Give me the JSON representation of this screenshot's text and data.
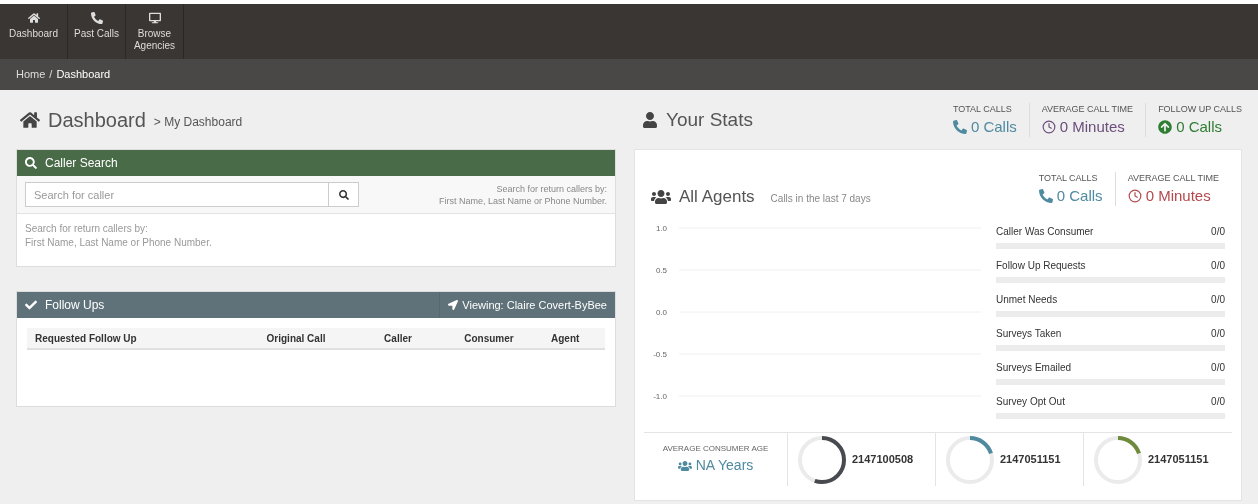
{
  "nav": [
    {
      "kind": "home",
      "label": "Dashboard"
    },
    {
      "kind": "phone",
      "label": "Past Calls"
    },
    {
      "kind": "monitor",
      "label": "Browse Agencies"
    }
  ],
  "breadcrumb": {
    "home": "Home",
    "separator": "/",
    "current": "Dashboard"
  },
  "page_title": {
    "title": "Dashboard",
    "subtitle": "> My Dashboard"
  },
  "caller_search": {
    "title": "Caller Search",
    "placeholder": "Search for caller",
    "hint_right": [
      "Search for return callers by:",
      "First Name, Last Name or Phone Number."
    ],
    "hint_body": [
      "Search for return callers by:",
      "First Name, Last Name or Phone Number."
    ]
  },
  "follow_ups": {
    "title": "Follow Ups",
    "viewing": "Viewing: Claire Covert-ByBee",
    "columns": [
      "Requested Follow Up",
      "Original Call",
      "Caller",
      "Consumer",
      "Agent"
    ]
  },
  "your_stats": {
    "title": "Your Stats",
    "stats": [
      {
        "kind": "phone",
        "label": "TOTAL CALLS",
        "value": "0 Calls",
        "color": "#4f8aa1"
      },
      {
        "kind": "clock",
        "label": "AVERAGE CALL TIME",
        "value": "0 Minutes",
        "color": "#6b4e7a"
      },
      {
        "kind": "up",
        "label": "FOLLOW UP CALLS",
        "value": "0 Calls",
        "color": "#2f7d32"
      }
    ]
  },
  "all_agents": {
    "title": "All Agents",
    "subtitle": "Calls in the last 7 days",
    "stats": [
      {
        "kind": "phone",
        "label": "TOTAL CALLS",
        "value": "0 Calls",
        "color": "#4f8aa1"
      },
      {
        "kind": "clock",
        "label": "AVERAGE CALL TIME",
        "value": "0 Minutes",
        "color": "#b5484c"
      }
    ],
    "empty_chart": {
      "y_axis_labels": [
        "1.0",
        "0.5",
        "0.0",
        "-0.5",
        "-1.0"
      ]
    },
    "metrics": [
      {
        "label": "Caller Was Consumer",
        "reading": "0/0",
        "level": 0
      },
      {
        "label": "Follow Up Requests",
        "reading": "0/0",
        "level": 0
      },
      {
        "label": "Unmet Needs",
        "reading": "0/0",
        "level": 0
      },
      {
        "label": "Surveys Taken",
        "reading": "0/0",
        "level": 0
      },
      {
        "label": "Surveys Emailed",
        "reading": "0/0",
        "level": 0
      },
      {
        "label": "Survey Opt Out",
        "reading": "0/0",
        "level": 0
      }
    ],
    "consumer_age": {
      "label": "AVERAGE CONSUMER AGE",
      "value": "NA Years"
    },
    "gauges": [
      {
        "value": "2147100508",
        "level": 0.55,
        "color": "#474b4f"
      },
      {
        "value": "2147051151",
        "level": 0.2,
        "color": "#4f8aa1"
      },
      {
        "value": "2147051151",
        "level": 0.2,
        "color": "#6f8a3a"
      }
    ]
  }
}
